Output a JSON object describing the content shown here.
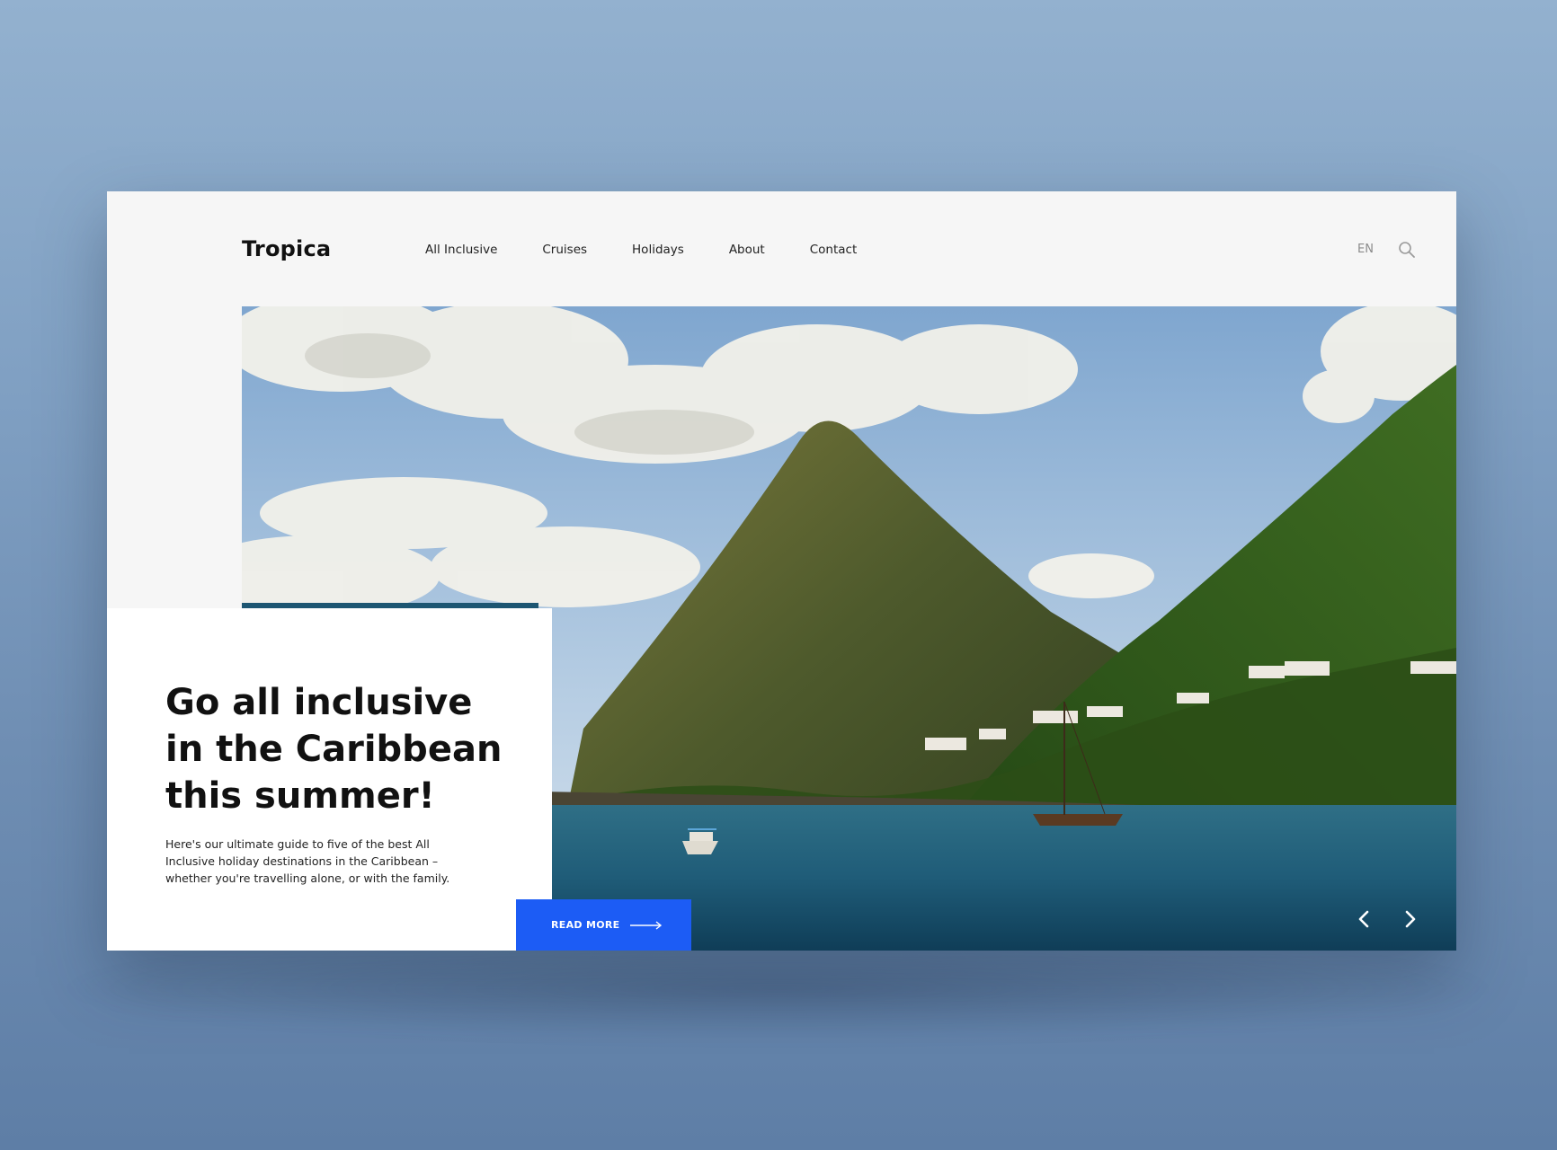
{
  "brand": {
    "logo": "Tropica"
  },
  "nav": {
    "items": [
      {
        "label": "All Inclusive"
      },
      {
        "label": "Cruises"
      },
      {
        "label": "Holidays"
      },
      {
        "label": "About"
      },
      {
        "label": "Contact"
      }
    ]
  },
  "header": {
    "language": "EN",
    "search_icon": "search-icon"
  },
  "hero": {
    "image_subject": "tropical mountain peak over a bay with boats",
    "headline_lines": [
      "Go all inclusive",
      "in the Caribbean",
      "this summer!"
    ],
    "subtext": "Here's our ultimate guide to five of the best All Inclusive holiday destinations in the Caribbean – whether you're travelling alone, or with the family.",
    "cta_label": "READ MORE",
    "cta_icon": "arrow-right-icon",
    "prev_icon": "chevron-left-icon",
    "next_icon": "chevron-right-icon"
  },
  "colors": {
    "accent": "#1c5cf5",
    "background": "#7f9fc2",
    "header_bg": "#f6f6f6"
  }
}
